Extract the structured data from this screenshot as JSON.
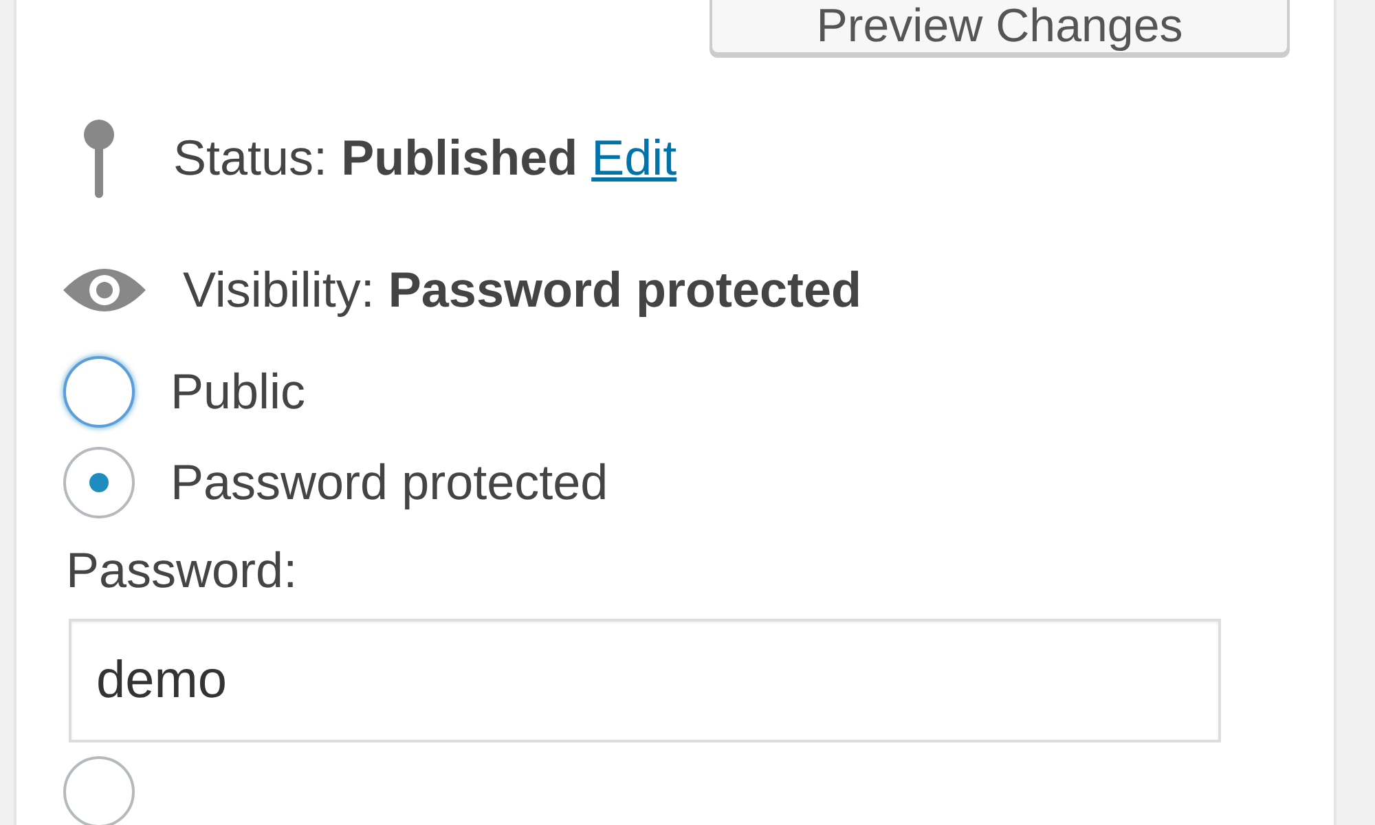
{
  "preview_button": {
    "label": "Preview Changes"
  },
  "status": {
    "label": "Status:",
    "value": "Published",
    "edit_link": "Edit"
  },
  "visibility": {
    "label": "Visibility:",
    "value": "Password protected",
    "options": [
      {
        "label": "Public",
        "selected": false,
        "focused": true
      },
      {
        "label": "Password protected",
        "selected": true,
        "focused": false
      },
      {
        "selected": false,
        "focused": false
      }
    ],
    "password": {
      "label": "Password:",
      "value": "demo"
    }
  }
}
